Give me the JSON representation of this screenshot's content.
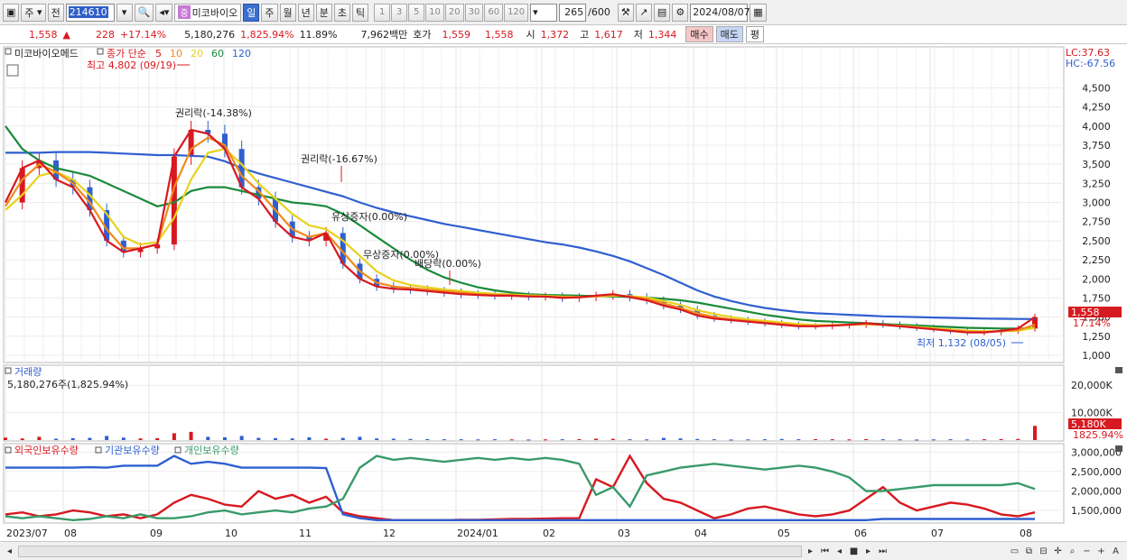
{
  "toolbar": {
    "market": "주",
    "prev_label": "전",
    "code": "214610",
    "stock_mark": "중",
    "stock_name": "미코바이오",
    "periods": [
      "일",
      "주",
      "월",
      "년",
      "분",
      "초",
      "틱"
    ],
    "selected_period": "일",
    "intervals": [
      "1",
      "3",
      "5",
      "10",
      "20",
      "30",
      "60",
      "120"
    ],
    "count": "265",
    "count_total": "/600",
    "date": "2024/08/07"
  },
  "quote": {
    "price": "1,558",
    "change": "228",
    "change_pct": "+17.14%",
    "volume": "5,180,276",
    "volume_pct": "1,825.94%",
    "turnover_pct": "11.89%",
    "amount": "7,962백만",
    "ask_label": "호가",
    "ask1": "1,559",
    "ask2": "1,558",
    "open_label": "시",
    "open": "1,372",
    "high_label": "고",
    "high": "1,617",
    "low_label": "저",
    "low": "1,344",
    "buy_label": "매수",
    "sell_label": "매도",
    "avg_label": "평"
  },
  "price_panel": {
    "title": "미코바이오메드",
    "ma_label": "종가 단순",
    "ma_periods": [
      {
        "label": "5",
        "color": "#d71920"
      },
      {
        "label": "10",
        "color": "#f08a1c"
      },
      {
        "label": "20",
        "color": "#e8d21c"
      },
      {
        "label": "60",
        "color": "#1a8a3a"
      },
      {
        "label": "120",
        "color": "#2f5fd0"
      }
    ],
    "lc": "LC:37.63",
    "hc": "HC:-67.56",
    "high_note": "최고 4,802 (09/19)",
    "low_note": "최저 1,132 (08/05)",
    "events": [
      "권리락(-14.38%)",
      "권리락(-16.67%)",
      "유상증자(0.00%)",
      "무상증자(0.00%)",
      "배당락(0.00%)"
    ],
    "current_price": "1,558",
    "current_pct": "17.14%"
  },
  "volume_panel": {
    "title": "거래량",
    "value": "5,180,276주(1,825.94%)",
    "current": "5,180K",
    "current_pct": "1825.94%"
  },
  "holdings_panel": {
    "legend": [
      {
        "label": "외국인보유수량",
        "color": "#d71920"
      },
      {
        "label": "기관보유수량",
        "color": "#2f5fd0"
      },
      {
        "label": "개인보유수량",
        "color": "#3a9a6a"
      }
    ]
  },
  "colors": {
    "up": "#d71920",
    "down": "#2f5fd0",
    "ma5": "#d71920",
    "ma10": "#f08a1c",
    "ma20": "#e8d21c",
    "ma60": "#1a8a3a",
    "ma120": "#2f5fd0"
  },
  "chart_data": [
    {
      "type": "line",
      "title": "미코바이오메드",
      "x": [
        "2023/07",
        "08",
        "09",
        "10",
        "11",
        "12",
        "2024/01",
        "02",
        "03",
        "04",
        "05",
        "06",
        "07",
        "08"
      ],
      "y_ticks": [
        "4,500",
        "4,250",
        "4,000",
        "3,750",
        "3,500",
        "3,250",
        "3,000",
        "2,750",
        "2,500",
        "2,250",
        "2,000",
        "1,750",
        "1,500",
        "1,250",
        "1,000"
      ],
      "ylim": [
        1000,
        4800
      ],
      "series": [
        {
          "name": "5",
          "values": [
            3000,
            3450,
            3550,
            3300,
            3200,
            2900,
            2500,
            2350,
            2400,
            2450,
            3600,
            3950,
            3900,
            3700,
            3200,
            3050,
            2750,
            2550,
            2500,
            2600,
            2200,
            2000,
            1900,
            1870,
            1860,
            1840,
            1820,
            1800,
            1790,
            1780,
            1780,
            1770,
            1770,
            1750,
            1760,
            1780,
            1800,
            1760,
            1720,
            1650,
            1600,
            1520,
            1480,
            1460,
            1440,
            1420,
            1400,
            1380,
            1380,
            1390,
            1400,
            1420,
            1400,
            1380,
            1360,
            1340,
            1320,
            1300,
            1300,
            1320,
            1350,
            1500
          ]
        },
        {
          "name": "10",
          "values": [
            2950,
            3300,
            3500,
            3400,
            3250,
            3000,
            2650,
            2400,
            2400,
            2450,
            3200,
            3700,
            3850,
            3750,
            3350,
            3150,
            2900,
            2650,
            2550,
            2600,
            2350,
            2100,
            1950,
            1900,
            1880,
            1860,
            1840,
            1820,
            1800,
            1790,
            1785,
            1775,
            1770,
            1760,
            1760,
            1775,
            1790,
            1770,
            1740,
            1680,
            1620,
            1550,
            1500,
            1470,
            1450,
            1430,
            1410,
            1390,
            1385,
            1390,
            1400,
            1410,
            1400,
            1385,
            1365,
            1345,
            1325,
            1310,
            1305,
            1315,
            1330,
            1400
          ]
        },
        {
          "name": "20",
          "values": [
            2900,
            3100,
            3350,
            3400,
            3300,
            3100,
            2850,
            2550,
            2450,
            2480,
            2800,
            3300,
            3650,
            3700,
            3500,
            3250,
            3050,
            2850,
            2700,
            2650,
            2500,
            2300,
            2100,
            1980,
            1920,
            1890,
            1860,
            1840,
            1820,
            1805,
            1795,
            1785,
            1778,
            1768,
            1765,
            1770,
            1780,
            1775,
            1755,
            1710,
            1660,
            1590,
            1540,
            1500,
            1470,
            1450,
            1430,
            1410,
            1395,
            1395,
            1400,
            1405,
            1398,
            1388,
            1372,
            1355,
            1338,
            1322,
            1315,
            1315,
            1322,
            1360
          ]
        },
        {
          "name": "60",
          "values": [
            4000,
            3700,
            3550,
            3450,
            3400,
            3350,
            3250,
            3150,
            3050,
            2950,
            3000,
            3150,
            3200,
            3200,
            3150,
            3100,
            3050,
            3000,
            2980,
            2950,
            2850,
            2700,
            2550,
            2400,
            2250,
            2120,
            2020,
            1950,
            1890,
            1850,
            1820,
            1800,
            1790,
            1785,
            1780,
            1775,
            1770,
            1765,
            1755,
            1740,
            1720,
            1690,
            1650,
            1610,
            1570,
            1530,
            1500,
            1470,
            1450,
            1440,
            1430,
            1420,
            1410,
            1400,
            1390,
            1380,
            1370,
            1360,
            1355,
            1350,
            1350,
            1355
          ]
        },
        {
          "name": "120",
          "values": [
            3650,
            3650,
            3650,
            3660,
            3660,
            3660,
            3650,
            3640,
            3630,
            3620,
            3620,
            3610,
            3600,
            3540,
            3450,
            3380,
            3320,
            3260,
            3200,
            3140,
            3080,
            3000,
            2930,
            2870,
            2820,
            2770,
            2720,
            2680,
            2640,
            2600,
            2560,
            2520,
            2480,
            2450,
            2410,
            2360,
            2300,
            2230,
            2140,
            2050,
            1950,
            1850,
            1770,
            1710,
            1660,
            1620,
            1590,
            1565,
            1550,
            1540,
            1530,
            1520,
            1510,
            1505,
            1500,
            1495,
            1490,
            1485,
            1480,
            1478,
            1476,
            1475
          ]
        }
      ]
    },
    {
      "type": "bar",
      "title": "거래량",
      "y_ticks": [
        "20,000K",
        "10,000K"
      ],
      "ylim": [
        0,
        25000
      ],
      "values": [
        900,
        600,
        1200,
        500,
        700,
        800,
        1500,
        900,
        600,
        700,
        2500,
        3000,
        1200,
        1000,
        1500,
        800,
        700,
        600,
        1000,
        500,
        800,
        1200,
        600,
        500,
        400,
        350,
        300,
        300,
        250,
        300,
        250,
        200,
        250,
        300,
        350,
        500,
        450,
        300,
        250,
        800,
        600,
        400,
        300,
        200,
        250,
        300,
        400,
        300,
        350,
        300,
        250,
        350,
        300,
        250,
        200,
        250,
        300,
        250,
        300,
        350,
        400,
        5180
      ]
    },
    {
      "type": "line",
      "title": "보유수량",
      "y_ticks": [
        "3,000,000",
        "2,500,000",
        "2,000,000",
        "1,500,000"
      ],
      "ylim": [
        1200000,
        3100000
      ],
      "series": [
        {
          "name": "외국인보유수량",
          "values": [
            1400000,
            1450000,
            1350000,
            1400000,
            1500000,
            1450000,
            1350000,
            1400000,
            1300000,
            1400000,
            1700000,
            1900000,
            1800000,
            1650000,
            1600000,
            2000000,
            1800000,
            1900000,
            1700000,
            1850000,
            1450000,
            1350000,
            1300000,
            1250000,
            1250000,
            1250000,
            1250000,
            1260000,
            1260000,
            1270000,
            1280000,
            1280000,
            1290000,
            1300000,
            1300000,
            2300000,
            2100000,
            2900000,
            2200000,
            1800000,
            1700000,
            1500000,
            1300000,
            1400000,
            1550000,
            1600000,
            1500000,
            1400000,
            1350000,
            1400000,
            1500000,
            1800000,
            2100000,
            1700000,
            1500000,
            1600000,
            1700000,
            1650000,
            1550000,
            1400000,
            1350000,
            1450000
          ]
        },
        {
          "name": "기관보유수량",
          "values": [
            2600000,
            2600000,
            2600000,
            2600000,
            2600000,
            2610000,
            2600000,
            2650000,
            2650000,
            2650000,
            2900000,
            2700000,
            2750000,
            2700000,
            2600000,
            2600000,
            2600000,
            2600000,
            2600000,
            2590000,
            1400000,
            1300000,
            1250000,
            1250000,
            1250000,
            1250000,
            1250000,
            1250000,
            1250000,
            1250000,
            1250000,
            1250000,
            1250000,
            1250000,
            1250000,
            1250000,
            1250000,
            1250000,
            1250000,
            1250000,
            1250000,
            1250000,
            1250000,
            1250000,
            1250000,
            1250000,
            1250000,
            1250000,
            1250000,
            1250000,
            1250000,
            1250000,
            1280000,
            1280000,
            1280000,
            1280000,
            1280000,
            1280000,
            1280000,
            1280000,
            1280000,
            1280000
          ]
        },
        {
          "name": "개인보유수량",
          "values": [
            1350000,
            1300000,
            1350000,
            1300000,
            1250000,
            1280000,
            1350000,
            1300000,
            1400000,
            1300000,
            1300000,
            1350000,
            1450000,
            1500000,
            1400000,
            1450000,
            1500000,
            1450000,
            1550000,
            1600000,
            1800000,
            2600000,
            2900000,
            2800000,
            2850000,
            2800000,
            2750000,
            2800000,
            2850000,
            2800000,
            2850000,
            2800000,
            2850000,
            2800000,
            2700000,
            1900000,
            2100000,
            1600000,
            2400000,
            2500000,
            2600000,
            2650000,
            2700000,
            2650000,
            2600000,
            2550000,
            2600000,
            2650000,
            2600000,
            2500000,
            2350000,
            2000000,
            2000000,
            2050000,
            2100000,
            2150000,
            2150000,
            2150000,
            2150000,
            2150000,
            2200000,
            2050000
          ]
        }
      ]
    }
  ]
}
